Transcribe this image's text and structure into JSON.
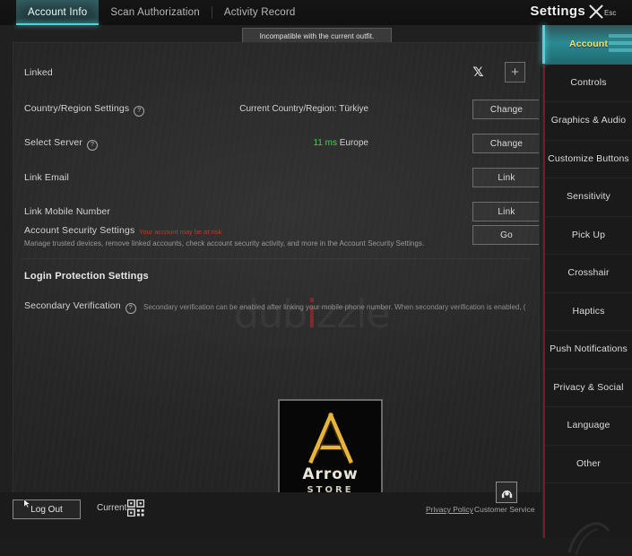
{
  "topbar": {
    "tabs": [
      {
        "label": "Account Info",
        "active": true
      },
      {
        "label": "Scan Authorization",
        "active": false
      },
      {
        "label": "Activity Record",
        "active": false
      }
    ],
    "settings_title": "Settings",
    "close_icon": "close-x-icon",
    "esc_label": "Esc"
  },
  "tooltip": {
    "text": "Incompatible with the current outfit."
  },
  "watermark": {
    "text_before": "dub",
    "text_dot": "i",
    "text_after": "zzle"
  },
  "main": {
    "rows": [
      {
        "label": "Linked",
        "value": "",
        "x_icon": "x-twitter-icon",
        "plus_icon": "plus-icon"
      },
      {
        "label": "Country/Region Settings",
        "help": "?",
        "value": "Current Country/Region: Türkiye",
        "button": "Change"
      },
      {
        "label": "Select Server",
        "help": "?",
        "ping": "11 ms",
        "region": "Europe",
        "button": "Change"
      },
      {
        "label": "Link Email",
        "button": "Link"
      },
      {
        "label": "Link Mobile Number",
        "button": "Link"
      },
      {
        "label": "Account Security Settings",
        "warning": "Your account may be at risk",
        "description": "Manage trusted devices, remove linked accounts, check account security activity, and more in the Account Security Settings.",
        "button": "Go"
      }
    ],
    "login_protection": {
      "section_title": "Login Protection Settings",
      "secondary_verification_label": "Secondary Verification",
      "help": "?",
      "secondary_verification_desc": "Secondary verification can be enabled after linking your mobile phone number. When secondary verification is enabled, ("
    },
    "logo": {
      "brand": "Arrow",
      "sub": "STORE",
      "mark": "a-letter-icon",
      "accent": "#e8b43a"
    }
  },
  "bottom": {
    "logout": "Log Out",
    "cursor_icon": "mouse-cursor-icon",
    "current_label": "Current",
    "qr_icon": "qr-code-icon",
    "privacy_policy": "Privacy Policy",
    "customer_service": "Customer Service",
    "customer_service_icon": "support-agent-icon"
  },
  "sidebar": {
    "items": [
      {
        "label": "Account",
        "active": true
      },
      {
        "label": "Controls",
        "active": false
      },
      {
        "label": "Graphics & Audio",
        "active": false
      },
      {
        "label": "Customize Buttons",
        "active": false
      },
      {
        "label": "Sensitivity",
        "active": false
      },
      {
        "label": "Pick Up",
        "active": false
      },
      {
        "label": "Crosshair",
        "active": false
      },
      {
        "label": "Haptics",
        "active": false
      },
      {
        "label": "Push Notifications",
        "active": false
      },
      {
        "label": "Privacy & Social",
        "active": false
      },
      {
        "label": "Language",
        "active": false
      },
      {
        "label": "Other",
        "active": false
      }
    ],
    "accent_active_bg": "#2b8a92",
    "accent_active_text": "#ffe14d",
    "rail_color": "#6d1f22"
  }
}
